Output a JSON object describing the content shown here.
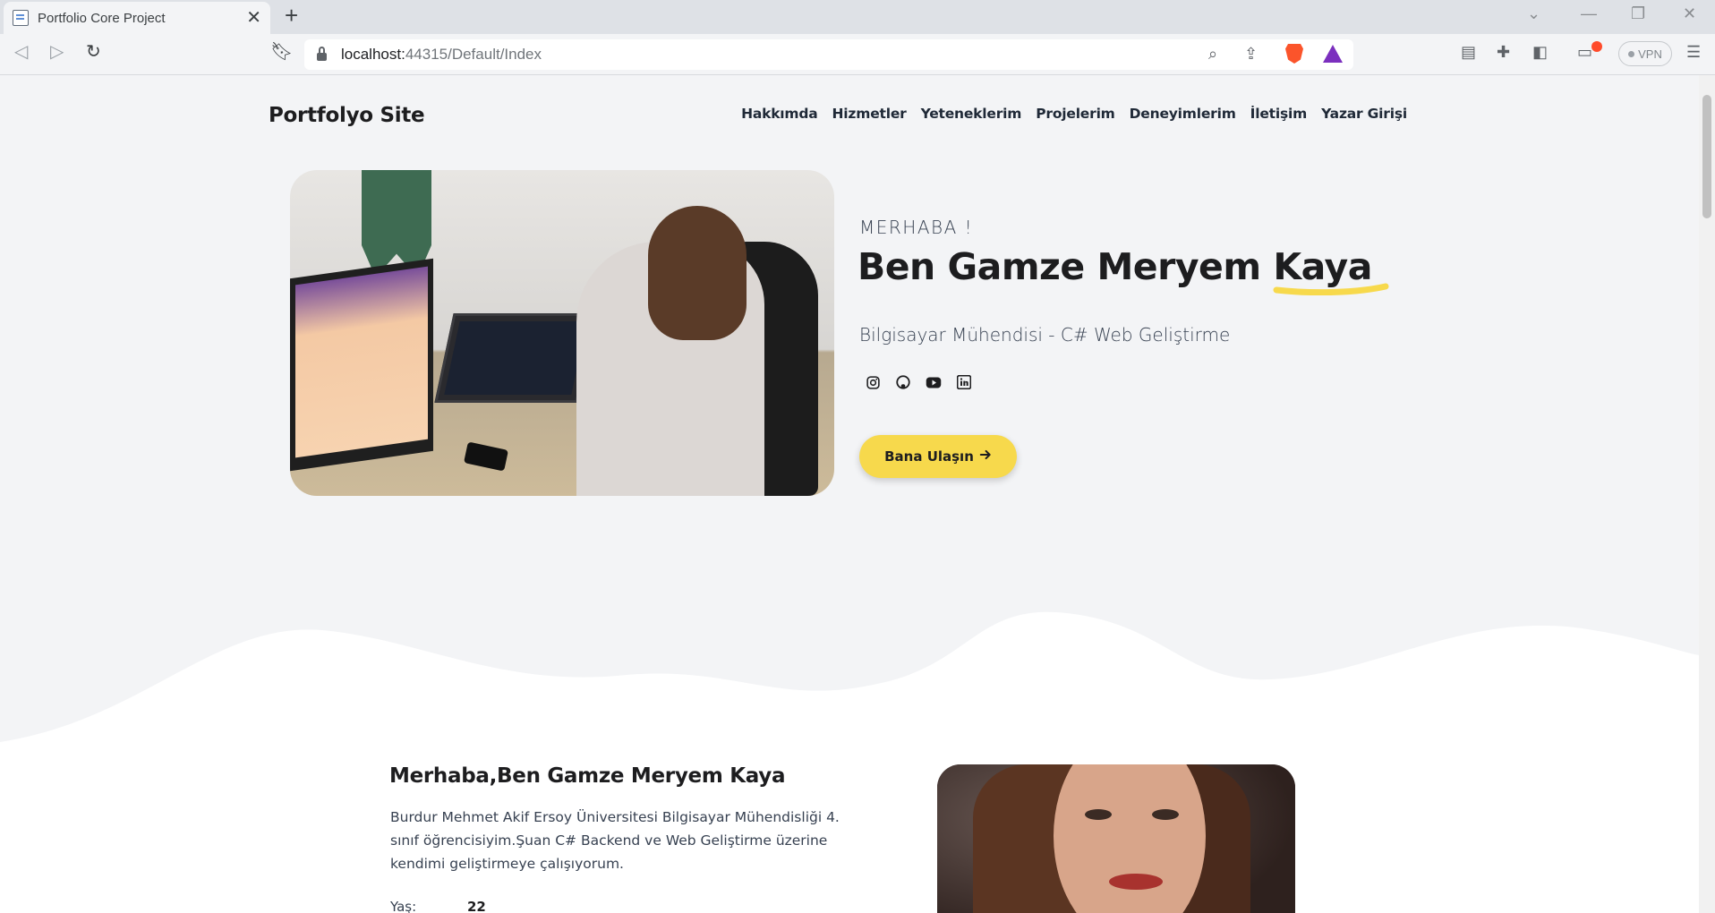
{
  "browser": {
    "tab_title": "Portfolio Core Project",
    "url_host": "localhost:",
    "url_path": "44315/Default/Index",
    "vpn_label": "VPN"
  },
  "site": {
    "brand": "Portfolyo Site",
    "nav": [
      "Hakkımda",
      "Hizmetler",
      "Yeteneklerim",
      "Projelerim",
      "Deneyimlerim",
      "İletişim",
      "Yazar Girişi"
    ]
  },
  "hero": {
    "greeting": "MERHABA !",
    "name_prefix": "Ben Gamze Meryem ",
    "name_highlight": "Kaya",
    "role": "Bilgisayar Mühendisi - C# Web Geliştirme",
    "socials": [
      "instagram-icon",
      "github-icon",
      "youtube-icon",
      "linkedin-icon"
    ],
    "cta_label": "Bana Ulaşın",
    "accent": "#f7d94c"
  },
  "about": {
    "title": "Merhaba,Ben Gamze Meryem Kaya",
    "text": "Burdur Mehmet Akif Ersoy Üniversitesi Bilgisayar Mühendisliği 4. sınıf öğrencisiyim.Şuan C# Backend ve Web Geliştirme üzerine kendimi geliştirmeye çalışıyorum.",
    "age_label": "Yaş:",
    "age_value": "22"
  }
}
